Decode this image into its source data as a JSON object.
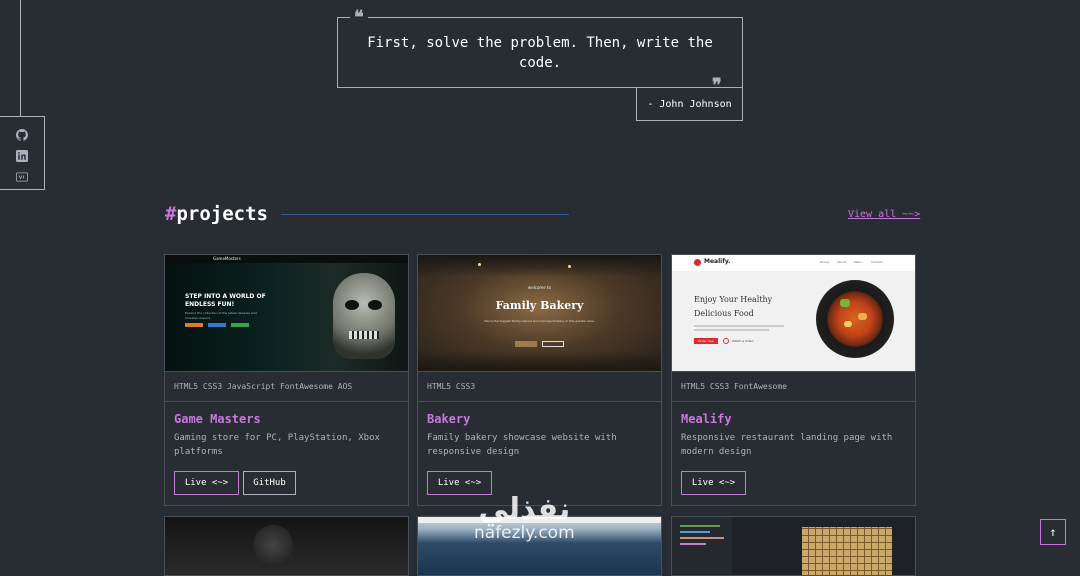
{
  "quote": {
    "text": "First, solve the problem. Then, write the code.",
    "author": "- John Johnson"
  },
  "media": [
    "github-icon",
    "linkedin-icon",
    "vercel-icon"
  ],
  "projects": {
    "hash": "#",
    "title": "projects",
    "view_all": "View all ~~>"
  },
  "cards": [
    {
      "techs": "HTML5 CSS3 JavaScript FontAwesome AOS",
      "title": "Game Masters",
      "desc": "Gaming store for PC, PlayStation, Xbox platforms",
      "live": "Live <~>",
      "github": "GitHub",
      "thumb": {
        "brand": "GameMasters",
        "headline": "STEP INTO A WORLD OF ENDLESS FUN!",
        "sub": "Explore the collection of the latest releases and timeless classics."
      }
    },
    {
      "techs": "HTML5 CSS3",
      "title": "Bakery",
      "desc": "Family bakery showcase website with responsive design",
      "live": "Live <~>",
      "thumb": {
        "kicker": "welcome to",
        "headline": "Family Bakery",
        "sub": "We're the biggest family owned and managed bakery in the greater area."
      }
    },
    {
      "techs": "HTML5 CSS3 FontAwesome",
      "title": "Mealify",
      "desc": "Responsive restaurant landing page with modern design",
      "live": "Live <~>",
      "thumb": {
        "brand": "Mealify.",
        "nav": [
          "Home",
          "About",
          "Menu",
          "Contact"
        ],
        "headline1": "Enjoy Your Healthy",
        "headline2": "Delicious Food",
        "cta": "Order now",
        "video": "Watch a Video"
      }
    }
  ],
  "scroll_top": "↑",
  "watermark": {
    "arabic": "نفذلي",
    "latin": "nafezly.com"
  },
  "colors": {
    "background": "#282c33",
    "accent": "#c778dd",
    "text": "#abb2bf",
    "white": "#ffffff"
  }
}
